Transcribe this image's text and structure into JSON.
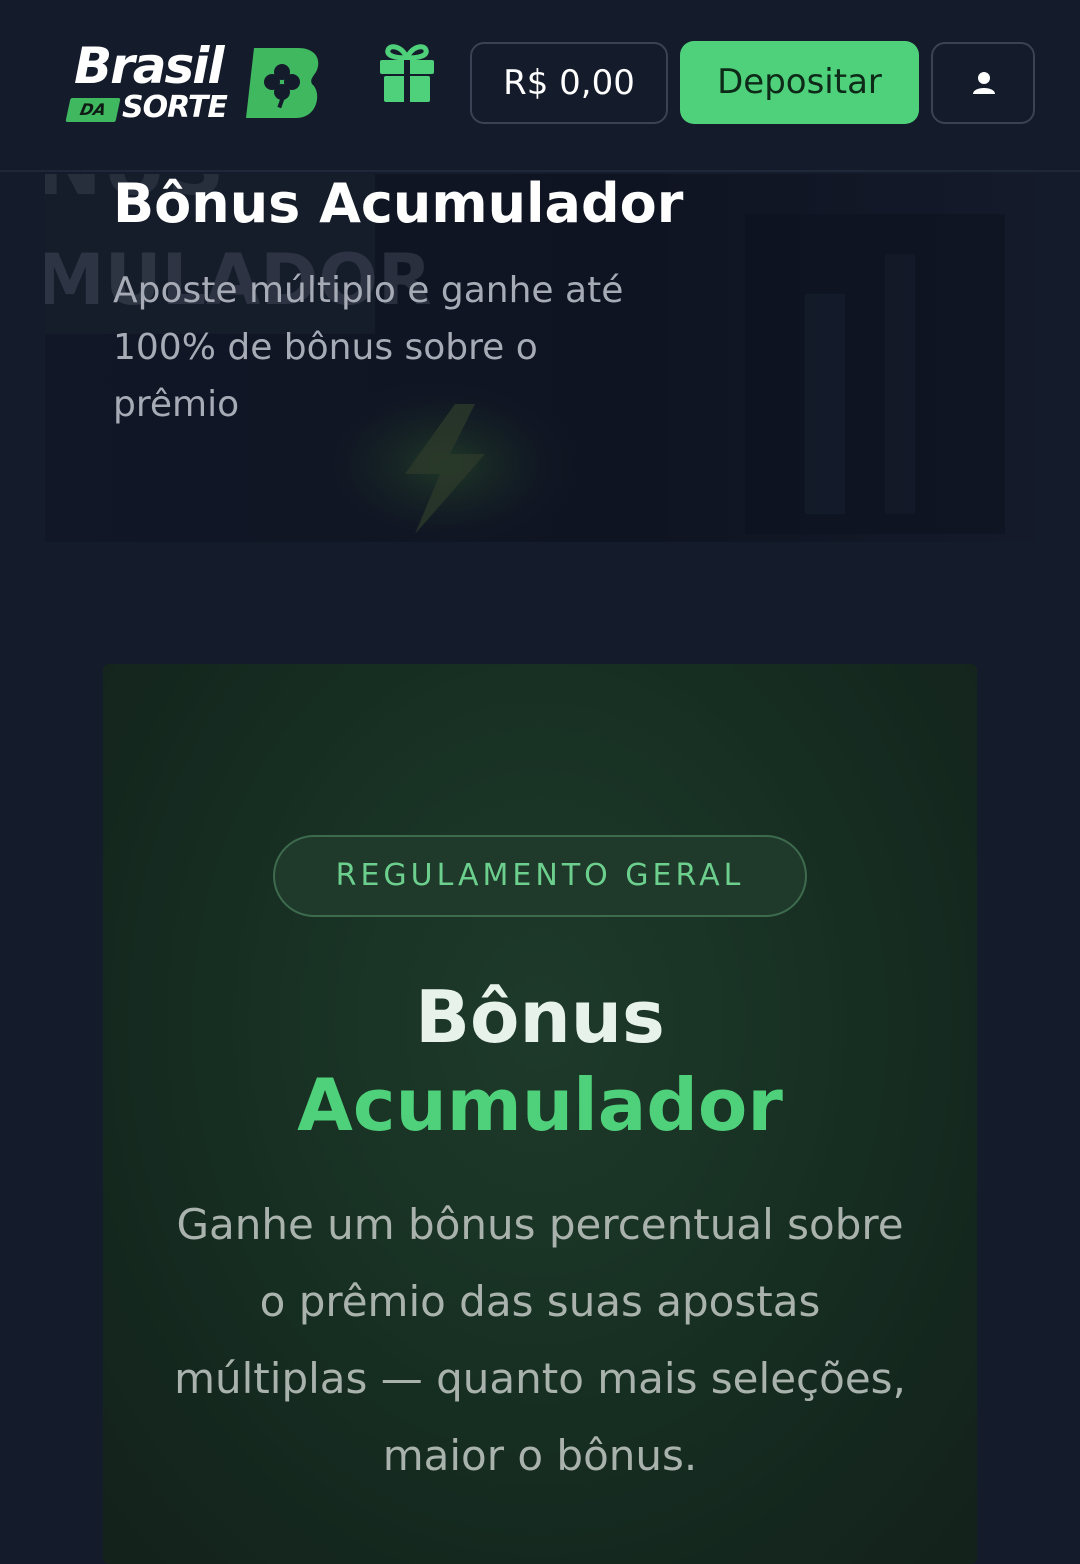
{
  "header": {
    "logo": {
      "word1": "Brasil",
      "badge": "DA",
      "word2": "SORTE"
    },
    "gift_icon": "gift-icon",
    "balance": "R$ 0,00",
    "deposit_label": "Depositar",
    "user_icon": "user-icon"
  },
  "hero": {
    "title": "Bônus Acumulador",
    "subtitle": "Aposte múltiplo e ganhe até 100% de bônus sobre o prêmio"
  },
  "card": {
    "badge": "REGULAMENTO GERAL",
    "title_line1": "Bônus",
    "title_line2": "Acumulador",
    "description": "Ganhe um bônus percentual sobre o prêmio das suas apostas múltiplas — quanto mais seleções, maior o bônus."
  },
  "colors": {
    "background": "#141b2b",
    "accent_green": "#4fd07a",
    "card_green": "#173023",
    "text_muted": "#a7abb6"
  }
}
